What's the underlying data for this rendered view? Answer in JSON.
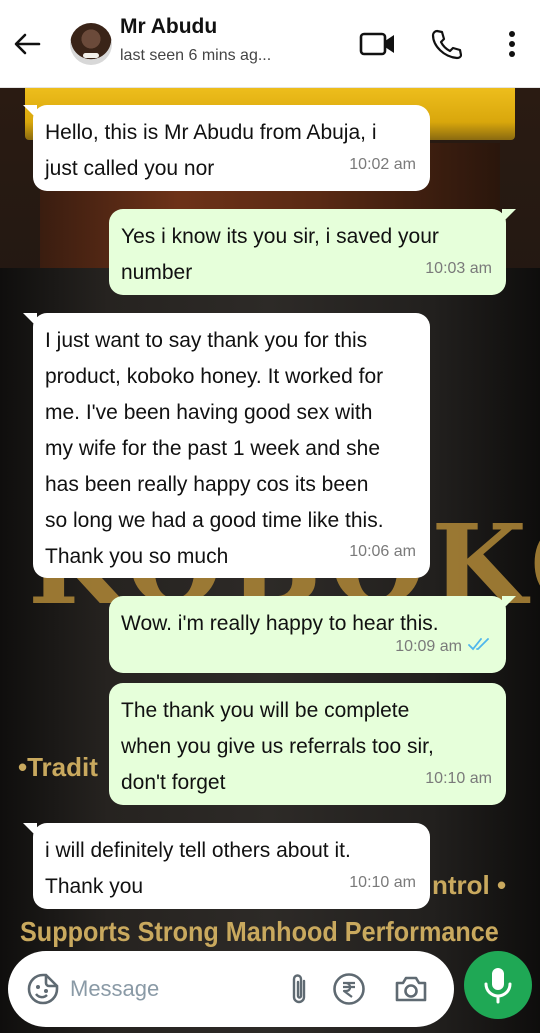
{
  "header": {
    "contact_name": "Mr Abudu",
    "status": "last seen 6 mins ag...",
    "icons": [
      "back-arrow-icon",
      "video-call-icon",
      "phone-icon",
      "more-options-icon"
    ]
  },
  "messages": [
    {
      "direction": "in",
      "text": "Hello, this is Mr Abudu from Abuja, i\njust called you nor",
      "time": "10:02 am"
    },
    {
      "direction": "out",
      "text": "Yes i know its you sir, i saved your\nnumber",
      "time": "10:03 am"
    },
    {
      "direction": "in",
      "text": "I just want to say thank you for this\nproduct, koboko honey. It worked for\nme. I've been having good sex with\nmy wife for the past 1 week and she\nhas been really happy cos its been\nso long we had a good time like this.\nThank you so much",
      "time": "10:06 am"
    },
    {
      "direction": "out",
      "text": "Wow. i'm really happy to hear this.",
      "time": "10:09 am",
      "read": true
    },
    {
      "direction": "out",
      "text": "The thank you will be complete\nwhen you give us referrals too sir,\ndon't forget",
      "time": "10:10 am"
    },
    {
      "direction": "in",
      "text": "i will definitely tell others about it.\nThank you",
      "time": "10:10 am"
    }
  ],
  "background": {
    "big_letters": "KOBOKO",
    "left_text": "•Tradit",
    "right_text": "ntrol •",
    "tagline": "Supports Strong Manhood Performance"
  },
  "composer": {
    "placeholder": "Message",
    "icons": [
      "sticker-icon",
      "attach-icon",
      "rupee-payment-icon",
      "camera-icon",
      "mic-icon"
    ]
  },
  "colors": {
    "incoming_bubble": "#ffffff",
    "outgoing_bubble": "#e6ffda",
    "accent_green": "#1fa855",
    "read_tick": "#4fb6ec"
  }
}
